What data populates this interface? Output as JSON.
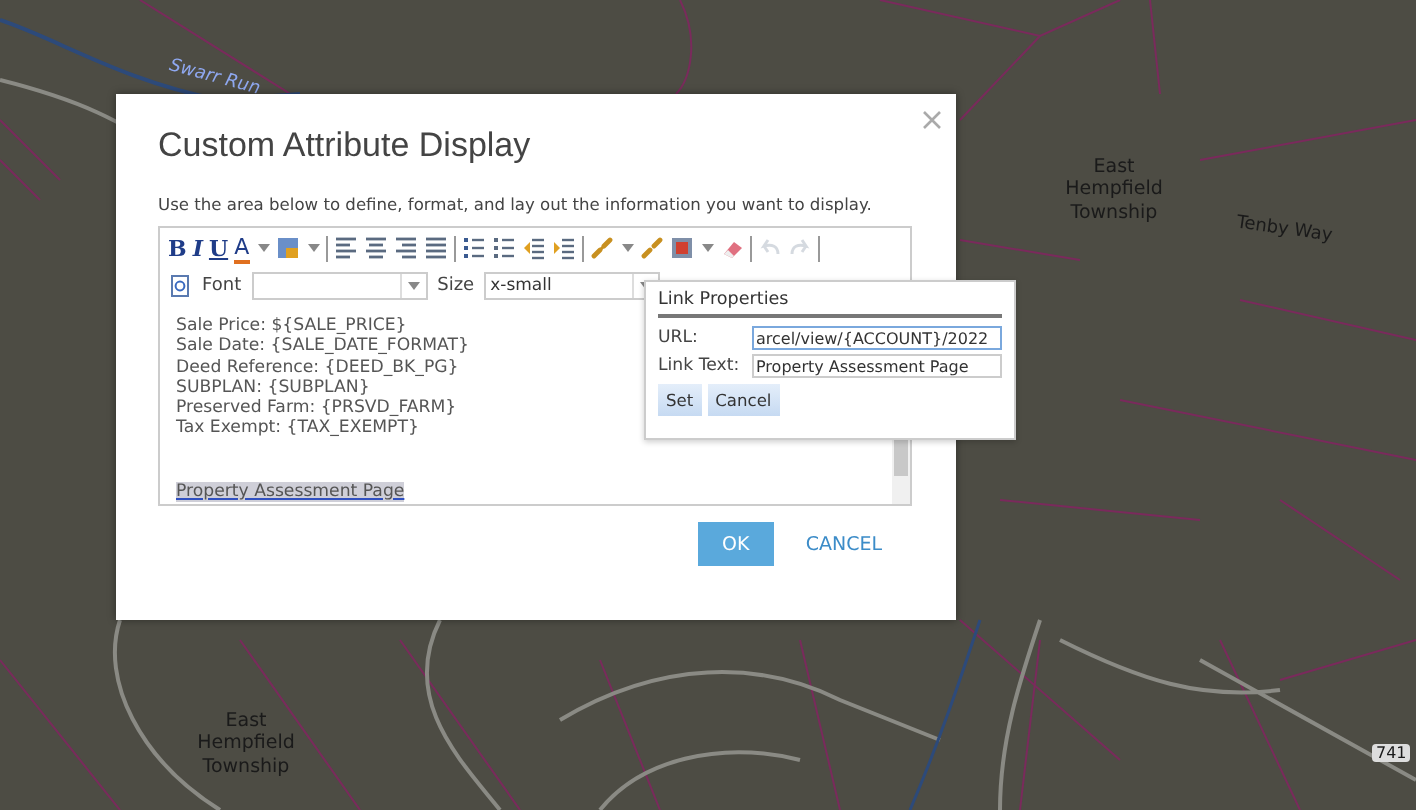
{
  "map": {
    "labels": [
      {
        "text": "Swarr Run",
        "kind": "water"
      },
      {
        "text": "East Hempfield Township",
        "kind": "area"
      },
      {
        "text": "Tenby Way",
        "kind": "street"
      },
      {
        "text": "East Hempfield Township",
        "kind": "area"
      },
      {
        "text": "741",
        "kind": "route"
      }
    ]
  },
  "dialog": {
    "title": "Custom Attribute Display",
    "description": "Use the area below to define, format, and lay out the information you want to display.",
    "toolbar": [
      {
        "kind": "bold",
        "label": "B",
        "disabled": false
      },
      {
        "kind": "italic",
        "label": "I",
        "disabled": false
      },
      {
        "kind": "underline",
        "label": "U",
        "disabled": false
      },
      {
        "kind": "font-color",
        "label": "A",
        "disabled": false
      },
      {
        "kind": "caret",
        "disabled": false
      },
      {
        "kind": "highlight",
        "disabled": false
      },
      {
        "kind": "caret",
        "disabled": false
      },
      {
        "kind": "separator"
      },
      {
        "kind": "align-left",
        "disabled": false
      },
      {
        "kind": "align-center",
        "disabled": false
      },
      {
        "kind": "align-right",
        "disabled": false
      },
      {
        "kind": "justify",
        "disabled": false
      },
      {
        "kind": "separator"
      },
      {
        "kind": "ordered-list",
        "disabled": false
      },
      {
        "kind": "bullet-list",
        "disabled": false
      },
      {
        "kind": "outdent",
        "disabled": false
      },
      {
        "kind": "indent",
        "disabled": false
      },
      {
        "kind": "separator"
      },
      {
        "kind": "link",
        "disabled": false
      },
      {
        "kind": "caret",
        "disabled": false
      },
      {
        "kind": "unlink",
        "disabled": false
      },
      {
        "kind": "image",
        "disabled": false
      },
      {
        "kind": "caret",
        "disabled": false
      },
      {
        "kind": "eraser",
        "disabled": false
      },
      {
        "kind": "separator"
      },
      {
        "kind": "undo",
        "disabled": true
      },
      {
        "kind": "redo",
        "disabled": true
      },
      {
        "kind": "separator"
      }
    ],
    "font": {
      "label": "Font"
    },
    "size": {
      "label": "Size",
      "value": "x-small"
    },
    "content_lines": [
      "Sale Price: ${SALE_PRICE}",
      "Sale Date: {SALE_DATE_FORMAT}",
      "Deed Reference: {DEED_BK_PG}",
      "SUBPLAN: {SUBPLAN}",
      "Preserved Farm: {PRSVD_FARM}",
      "Tax Exempt: {TAX_EXEMPT}"
    ],
    "link": {
      "text": "Property Assessment Page",
      "selected": true
    },
    "link_popup": {
      "title": "Link Properties",
      "url_label": "URL:",
      "url_value": "arcel/view/{ACCOUNT}/2022",
      "text_label": "Link Text:",
      "text_value": "Property Assessment Page",
      "buttons": [
        "Set",
        "Cancel"
      ]
    },
    "buttons": [
      {
        "label": "OK",
        "kind": "primary"
      },
      {
        "label": "CANCEL",
        "kind": "link"
      }
    ]
  }
}
